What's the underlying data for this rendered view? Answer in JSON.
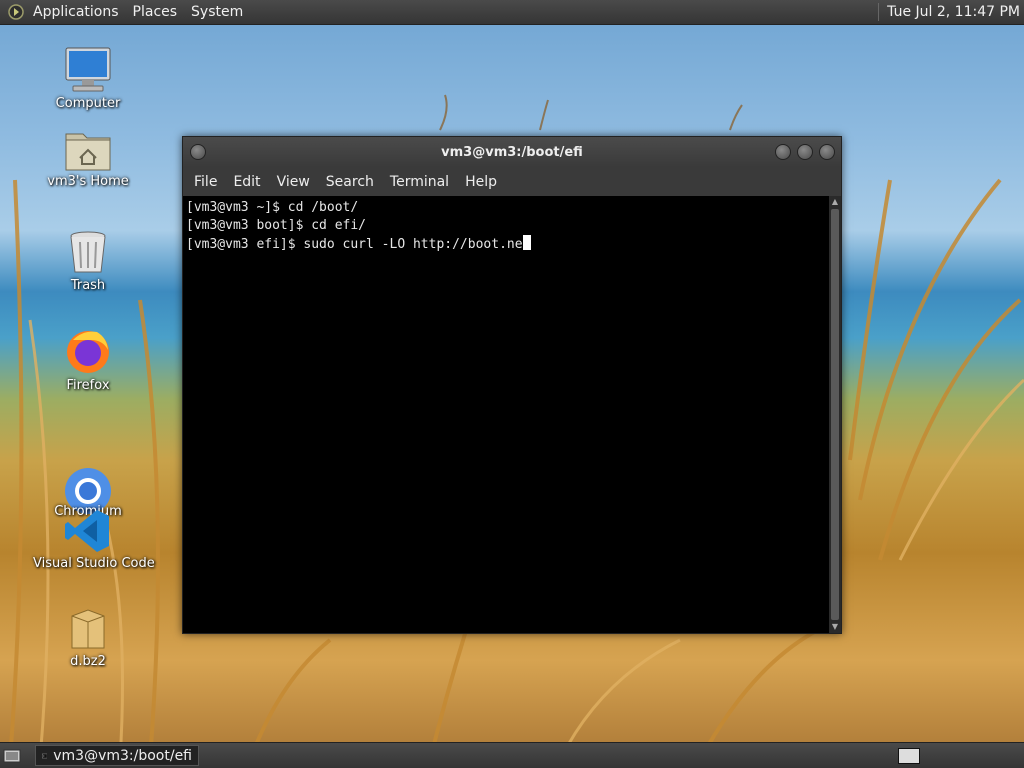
{
  "top_panel": {
    "menus": [
      "Applications",
      "Places",
      "System"
    ],
    "clock": "Tue Jul  2, 11:47 PM"
  },
  "desktop_icons": {
    "computer": {
      "label": "Computer",
      "icon": "computer-icon"
    },
    "home": {
      "label": "vm3's Home",
      "icon": "home-folder-icon"
    },
    "trash": {
      "label": "Trash",
      "icon": "trash-icon"
    },
    "firefox": {
      "label": "Firefox",
      "icon": "firefox-icon"
    },
    "chromium": {
      "label": "Chromium",
      "icon": "chromium-icon"
    },
    "vscode": {
      "label": "Visual Studio Code",
      "icon": "vscode-icon"
    },
    "archive": {
      "label": "d.bz2",
      "icon": "archive-icon"
    }
  },
  "terminal": {
    "title": "vm3@vm3:/boot/efi",
    "menu": [
      "File",
      "Edit",
      "View",
      "Search",
      "Terminal",
      "Help"
    ],
    "lines": [
      "[vm3@vm3 ~]$ cd /boot/",
      "[vm3@vm3 boot]$ cd efi/",
      "[vm3@vm3 efi]$ sudo curl -LO http://boot.ne"
    ]
  },
  "bottom_panel": {
    "task_label": "vm3@vm3:/boot/efi"
  }
}
